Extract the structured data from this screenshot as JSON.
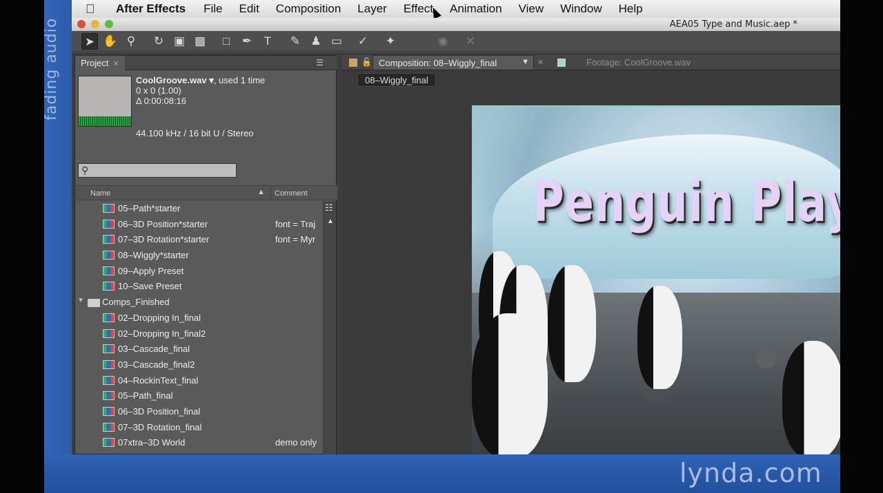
{
  "side_caption": "fading audio",
  "watermark": "lynda.com",
  "menubar": {
    "app": "After Effects",
    "items": [
      "File",
      "Edit",
      "Composition",
      "Layer",
      "Effect",
      "Animation",
      "View",
      "Window",
      "Help"
    ]
  },
  "window": {
    "title": "AEA05 Type and Music.aep *"
  },
  "toolbar": {
    "tools": [
      "selection-tool",
      "hand-tool",
      "zoom-tool",
      "rotate-tool",
      "camera-tool",
      "pan-behind-tool",
      "rectangle-tool",
      "pen-tool",
      "type-tool",
      "brush-tool",
      "clone-stamp-tool",
      "eraser-tool",
      "roto-brush-tool",
      "puppet-pin-tool"
    ]
  },
  "project_panel": {
    "tab_label": "Project",
    "selected_item": {
      "name": "CoolGroove.wav ▾",
      "usage": ", used 1 time",
      "dimensions": "0 x 0 (1.00)",
      "duration": "Δ 0:00:08:16",
      "audio_info": "44.100 kHz / 16 bit U / Stereo"
    },
    "search_placeholder": "",
    "columns": {
      "name": "Name",
      "comment": "Comment"
    },
    "items": [
      {
        "name": "05–Path*starter",
        "comment": "",
        "type": "comp"
      },
      {
        "name": "06–3D Position*starter",
        "comment": "font = Traj",
        "type": "comp"
      },
      {
        "name": "07–3D Rotation*starter",
        "comment": "font = Myr",
        "type": "comp"
      },
      {
        "name": "08–Wiggly*starter",
        "comment": "",
        "type": "comp"
      },
      {
        "name": "09–Apply Preset",
        "comment": "",
        "type": "comp"
      },
      {
        "name": "10–Save Preset",
        "comment": "",
        "type": "comp"
      },
      {
        "name": "Comps_Finished",
        "comment": "",
        "type": "folder"
      },
      {
        "name": "02–Dropping In_final",
        "comment": "",
        "type": "comp"
      },
      {
        "name": "02–Dropping In_final2",
        "comment": "",
        "type": "comp"
      },
      {
        "name": "03–Cascade_final",
        "comment": "",
        "type": "comp"
      },
      {
        "name": "03–Cascade_final2",
        "comment": "",
        "type": "comp"
      },
      {
        "name": "04–RockinText_final",
        "comment": "",
        "type": "comp"
      },
      {
        "name": "05–Path_final",
        "comment": "",
        "type": "comp"
      },
      {
        "name": "06–3D Position_final",
        "comment": "",
        "type": "comp"
      },
      {
        "name": "07–3D Rotation_final",
        "comment": "",
        "type": "comp"
      },
      {
        "name": "07xtra–3D World",
        "comment": "demo only",
        "type": "comp"
      }
    ]
  },
  "composition_panel": {
    "active_tab": "Composition: 08–Wiggly_final",
    "footage_tab": "Footage: CoolGroove.wav",
    "breadcrumb": "08–Wiggly_final",
    "viewer_title": "Penguin Play"
  }
}
